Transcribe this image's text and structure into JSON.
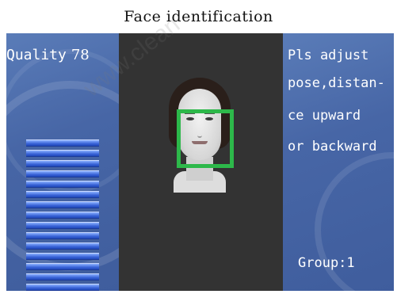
{
  "header": {
    "title": "Face identification"
  },
  "watermark": {
    "text": "www.clean"
  },
  "quality": {
    "label": "Quality",
    "value": "78",
    "bar_count": 15
  },
  "prompt": {
    "lines": [
      "Pls adjust",
      "pose,distan-",
      "ce upward",
      "or backward"
    ]
  },
  "group": {
    "text": "Group:1"
  },
  "colors": {
    "panel": "#4766a6",
    "camera_bg": "#333333",
    "detect_box": "#2db84a",
    "quality_bar": "#3a64d8"
  }
}
